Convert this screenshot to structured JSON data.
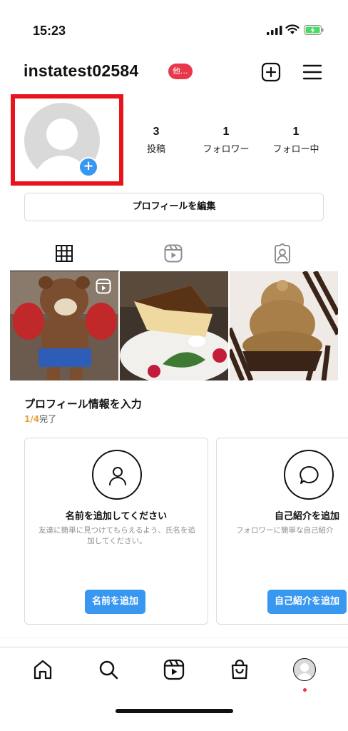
{
  "status_bar": {
    "time": "15:23"
  },
  "header": {
    "username": "instatest02584",
    "badge": "他..."
  },
  "stats": [
    {
      "count": "3",
      "label": "投稿"
    },
    {
      "count": "1",
      "label": "フォロワー"
    },
    {
      "count": "1",
      "label": "フォロー中"
    }
  ],
  "edit_profile_label": "プロフィールを編集",
  "tabs": [
    "grid-icon",
    "reels-icon",
    "tagged-icon"
  ],
  "posts": [
    "bear-plush-photo",
    "cheesecake-photo",
    "mont-blanc-photo"
  ],
  "profile_setup": {
    "title": "プロフィール情報を入力",
    "progress_done": "1/4",
    "progress_suffix": "完了",
    "cards": [
      {
        "title": "名前を追加してください",
        "description": "友達に簡単に見つけてもらえるよう、氏名を追加してください。",
        "button": "名前を追加"
      },
      {
        "title": "自己紹介を追加",
        "description": "フォロワーに簡単な自己紹介",
        "button": "自己紹介を追加"
      }
    ]
  },
  "nav": [
    "home-icon",
    "search-icon",
    "reels-icon",
    "shop-icon",
    "profile-avatar"
  ],
  "colors": {
    "highlight_frame": "#e8141c",
    "accent_blue": "#3897f0",
    "badge_red": "#e8364a",
    "progress_orange": "#e8a33d"
  }
}
